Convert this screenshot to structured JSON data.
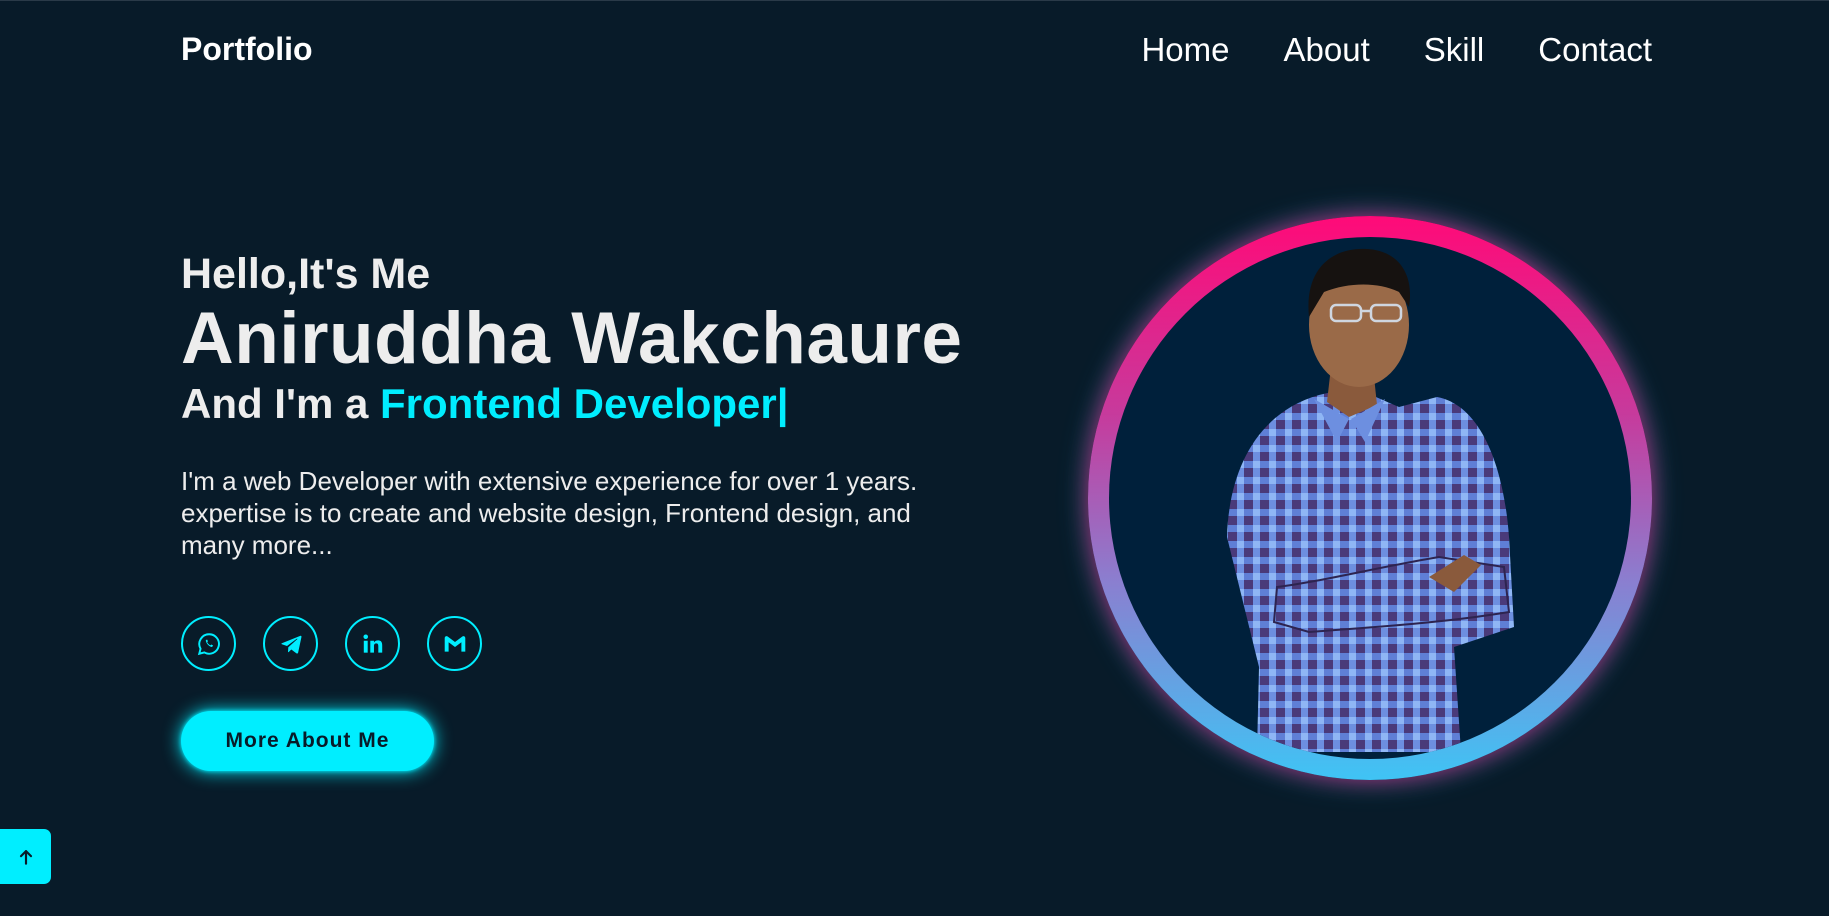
{
  "header": {
    "logo": "Portfolio",
    "nav": [
      "Home",
      "About",
      "Skill",
      "Contact"
    ]
  },
  "hero": {
    "greeting": "Hello,It's Me",
    "name": "Aniruddha Wakchaure",
    "role_prefix": "And I'm a ",
    "role_accent": "Frontend Developer|",
    "description": "I'm a web Developer with extensive experience for over 1 years. expertise is to create and website design, Frontend design, and many more...",
    "button_label": "More About Me"
  },
  "socials": [
    {
      "icon": "whatsapp-icon"
    },
    {
      "icon": "telegram-icon"
    },
    {
      "icon": "linkedin-icon"
    },
    {
      "icon": "gmail-icon"
    }
  ],
  "colors": {
    "background": "#081b29",
    "accent": "#00eeff",
    "ring_top": "#ff0a78",
    "ring_bottom": "#3fc4f5",
    "text": "#ededed"
  }
}
